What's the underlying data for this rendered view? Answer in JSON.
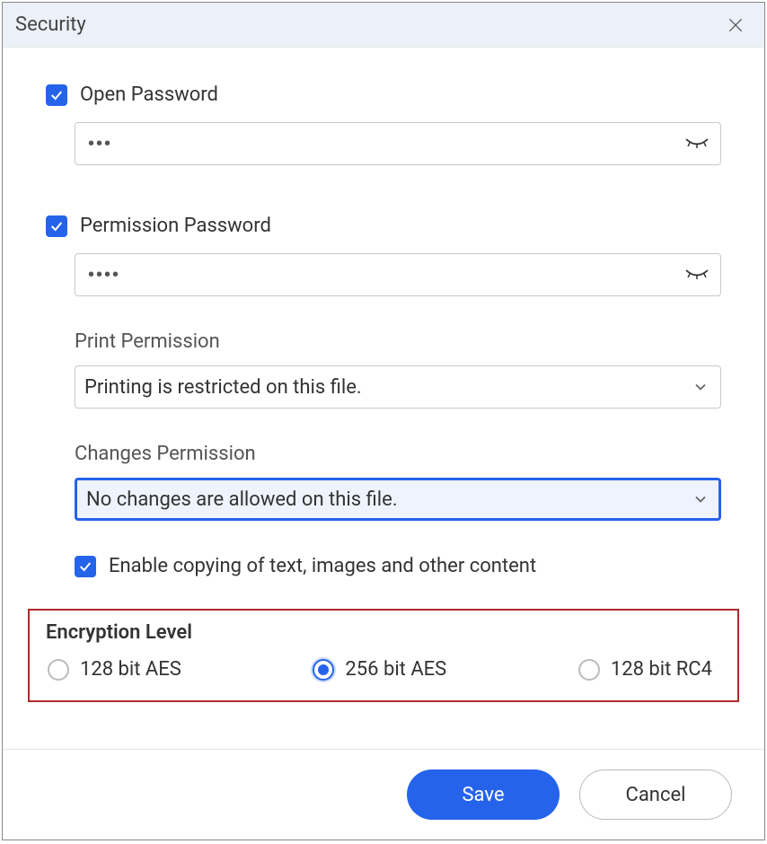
{
  "dialog": {
    "title": "Security"
  },
  "open_password": {
    "label": "Open Password",
    "checked": true,
    "value": "•••"
  },
  "permission_password": {
    "label": "Permission Password",
    "checked": true,
    "value": "••••"
  },
  "print_permission": {
    "label": "Print Permission",
    "value": "Printing is restricted on this file."
  },
  "changes_permission": {
    "label": "Changes Permission",
    "value": "No changes are allowed on this file.",
    "focused": true
  },
  "enable_copying": {
    "label": "Enable copying of text, images and other content",
    "checked": true
  },
  "encryption": {
    "title": "Encryption Level",
    "options": [
      {
        "label": "128 bit AES",
        "selected": false
      },
      {
        "label": "256 bit AES",
        "selected": true
      },
      {
        "label": "128 bit RC4",
        "selected": false
      }
    ]
  },
  "buttons": {
    "save": "Save",
    "cancel": "Cancel"
  }
}
